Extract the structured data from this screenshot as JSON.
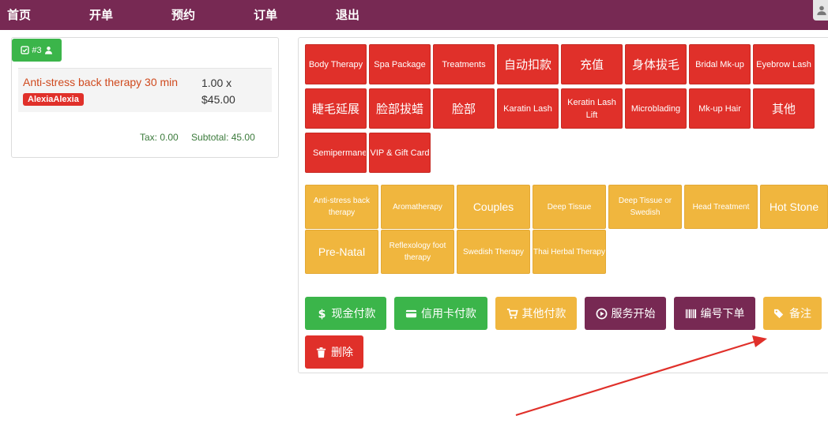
{
  "nav": {
    "items": [
      "首页",
      "开单",
      "预约",
      "订单",
      "退出"
    ]
  },
  "order": {
    "badge_label": "#3",
    "item_name": "Anti-stress back therapy 30 min",
    "staff": "AlexiaAlexia",
    "qty": "1.00 x",
    "price": "$45.00",
    "tax": "Tax: 0.00",
    "subtotal": "Subtotal: 45.00"
  },
  "categories": [
    "Body Therapy",
    "Spa Package",
    "Treatments",
    "自动扣款",
    "充值",
    "身体拔毛",
    "Bridal Mk-up",
    "Eyebrow Lash",
    "睫毛延展",
    "脸部拔蜡",
    "脸部",
    "Karatin Lash",
    "Keratin Lash Lift",
    "Microblading",
    "Mk-up Hair",
    "其他",
    "Semipermanent",
    "VIP & Gift Card"
  ],
  "services": [
    "Anti-stress back therapy",
    "Aromatherapy",
    "Couples",
    "Deep Tissue",
    "Deep Tissue or Swedish",
    "Head Treatment",
    "Hot Stone",
    "Pre-Natal",
    "Reflexology foot therapy",
    "Swedish Therapy",
    "Thai Herbal Therapy"
  ],
  "actions": {
    "cash": "现金付款",
    "card": "信用卡付款",
    "other": "其他付款",
    "start": "服务开始",
    "code": "编号下单",
    "note": "备注",
    "delete": "删除"
  },
  "colors": {
    "nav": "#772953",
    "category": "#e0302a",
    "service": "#f0b63e",
    "green": "#3bb54a",
    "arrow": "#e0302a"
  }
}
